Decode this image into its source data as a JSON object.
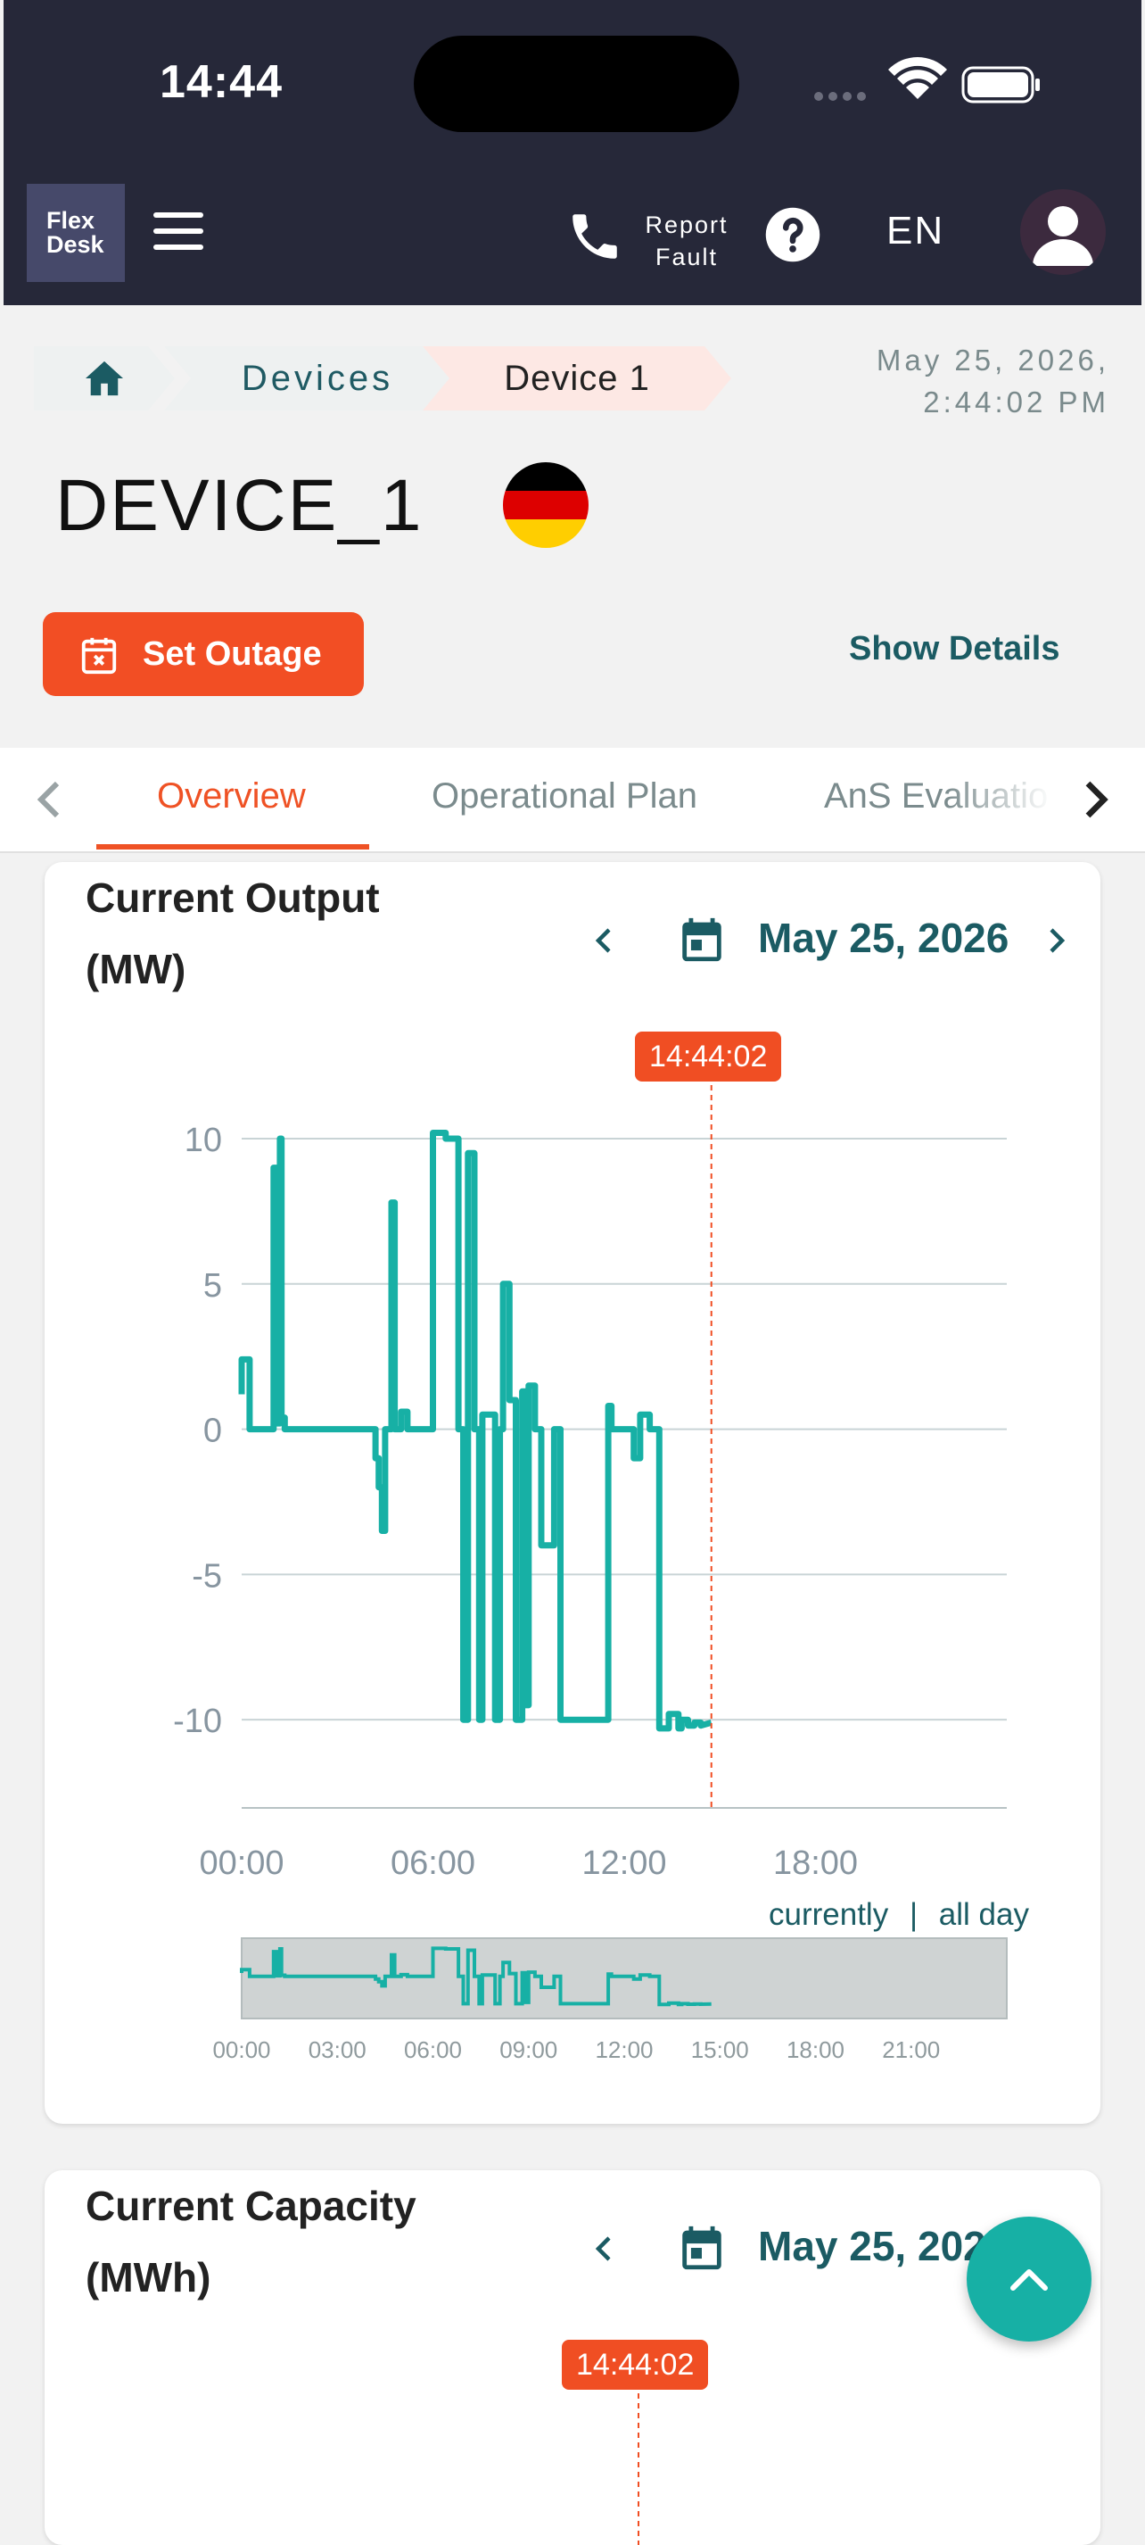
{
  "status_bar": {
    "time": "14:44"
  },
  "app_bar": {
    "logo_line1": "Flex",
    "logo_line2": "Desk",
    "report_line1": "Report",
    "report_line2": "Fault",
    "language": "EN"
  },
  "breadcrumb": {
    "items": [
      "Devices",
      "Device 1"
    ]
  },
  "timestamp": {
    "line1": "May 25, 2026,",
    "line2": "2:44:02 PM"
  },
  "device": {
    "name": "DEVICE_1",
    "flag_colors": [
      "#000000",
      "#dd0000",
      "#ffce00"
    ]
  },
  "actions": {
    "set_outage": "Set Outage",
    "show_details": "Show Details"
  },
  "tabs": [
    "Overview",
    "Operational Plan",
    "AnS Evaluatio"
  ],
  "cards": {
    "output": {
      "title_line1": "Current Output",
      "title_line2": "(MW)",
      "date": "May 25, 2026",
      "now_label": "14:44:02",
      "range_currently": "currently",
      "range_sep": "|",
      "range_all_day": "all day"
    },
    "capacity": {
      "title_line1": "Current Capacity",
      "title_line2": "(MWh)",
      "date": "May 25, 2026",
      "now_label": "14:44:02"
    }
  },
  "colors": {
    "accent": "#f24e24",
    "teal": "#17b0a5",
    "dark_teal": "#1b5b63",
    "appbar": "#262839"
  },
  "chart_data": {
    "type": "line",
    "title": "Current Output (MW)",
    "xlabel": "",
    "ylabel": "",
    "x_unit": "hours",
    "xlim": [
      0,
      24
    ],
    "ylim": [
      -11.5,
      10
    ],
    "y_ticks": [
      10,
      5,
      0,
      -5,
      -10
    ],
    "x_ticks": [
      "00:00",
      "06:00",
      "12:00",
      "18:00"
    ],
    "navigator_ticks": [
      "00:00",
      "03:00",
      "06:00",
      "09:00",
      "12:00",
      "15:00",
      "18:00",
      "21:00"
    ],
    "now_hour": 14.734,
    "grid": true,
    "series": [
      {
        "color": "#17b0a5",
        "x": [
          0.0,
          0.0,
          0.25,
          0.25,
          0.3,
          0.3,
          1.0,
          1.0,
          1.1,
          1.1,
          1.2,
          1.2,
          1.25,
          1.25,
          1.35,
          1.35,
          2.0,
          2.0,
          4.2,
          4.2,
          4.3,
          4.3,
          4.4,
          4.4,
          4.5,
          4.5,
          4.7,
          4.7,
          4.8,
          4.8,
          5.0,
          5.0,
          5.2,
          5.2,
          5.5,
          5.5,
          6.0,
          6.0,
          6.4,
          6.4,
          6.8,
          6.8,
          6.95,
          6.95,
          7.1,
          7.1,
          7.3,
          7.3,
          7.45,
          7.45,
          7.55,
          7.55,
          7.95,
          7.95,
          8.1,
          8.1,
          8.2,
          8.2,
          8.4,
          8.4,
          8.6,
          8.6,
          8.8,
          8.8,
          8.9,
          8.9,
          9.0,
          9.0,
          9.2,
          9.2,
          9.4,
          9.4,
          9.8,
          9.8,
          10.0,
          10.0,
          11.5,
          11.5,
          11.6,
          11.6,
          12.3,
          12.3,
          12.5,
          12.5,
          12.8,
          12.8,
          13.1,
          13.1,
          13.3,
          13.3,
          13.4,
          13.4,
          13.7,
          13.7,
          13.8,
          13.8,
          14.0,
          14.0,
          14.2,
          14.2,
          14.4,
          14.4,
          14.734
        ],
        "y": [
          1.2,
          2.4,
          2.4,
          0.0,
          0.0,
          0.0,
          0.0,
          9.0,
          9.0,
          0.2,
          0.2,
          10.0,
          10.0,
          0.4,
          0.4,
          0.0,
          0.0,
          0.0,
          0.0,
          -1.0,
          -1.0,
          -2.0,
          -2.0,
          -3.5,
          -3.5,
          0.0,
          0.0,
          7.8,
          7.8,
          0.0,
          0.0,
          0.6,
          0.6,
          0.0,
          0.0,
          0.0,
          0.0,
          10.2,
          10.2,
          10.0,
          10.0,
          0.0,
          0.0,
          -10.0,
          -10.0,
          9.5,
          9.5,
          0.0,
          0.0,
          -10.0,
          -10.0,
          0.5,
          0.5,
          -10.0,
          -10.0,
          0.0,
          0.0,
          5.0,
          5.0,
          1.0,
          1.0,
          -10.0,
          -10.0,
          1.3,
          1.3,
          -9.5,
          -9.5,
          1.5,
          1.5,
          0.0,
          0.0,
          -4.0,
          -4.0,
          0.0,
          0.0,
          -10.0,
          -10.0,
          0.8,
          0.8,
          0.0,
          0.0,
          -1.0,
          -1.0,
          0.5,
          0.5,
          0.0,
          0.0,
          -10.3,
          -10.3,
          -10.3,
          -10.3,
          -9.8,
          -9.8,
          -10.3,
          -10.3,
          -10.0,
          -10.0,
          -10.2,
          -10.2,
          -10.1,
          -10.1,
          -10.2,
          -10.1
        ]
      }
    ]
  }
}
